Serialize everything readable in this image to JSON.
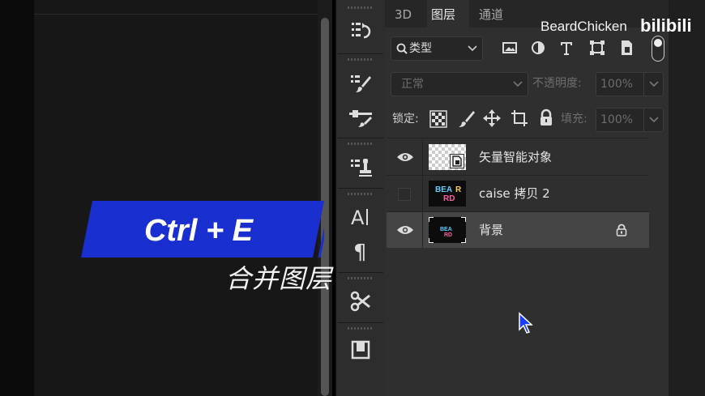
{
  "tabs": [
    {
      "label": "3D"
    },
    {
      "label": "图层"
    },
    {
      "label": "通道"
    }
  ],
  "filter": {
    "kind_label": "类型"
  },
  "blend": {
    "mode": "正常",
    "opacity_label": "不透明度:",
    "opacity_value": "100%"
  },
  "lock": {
    "label": "锁定:",
    "fill_label": "填充:",
    "fill_value": "100%"
  },
  "layers": [
    {
      "name": "矢量智能对象",
      "visible": true
    },
    {
      "name": "caise 拷贝 2",
      "visible": false
    },
    {
      "name": "背景",
      "visible": true,
      "locked": true
    }
  ],
  "overlay": {
    "shortcut": "Ctrl + E",
    "caption": "合并图层",
    "banner_color": "#1a2fd0"
  },
  "watermark": {
    "author": "BeardChicken",
    "site": "bilibili"
  },
  "colors": {
    "panel": "#2f2f2f",
    "selected_row": "#454545",
    "canvas": "#171717"
  }
}
